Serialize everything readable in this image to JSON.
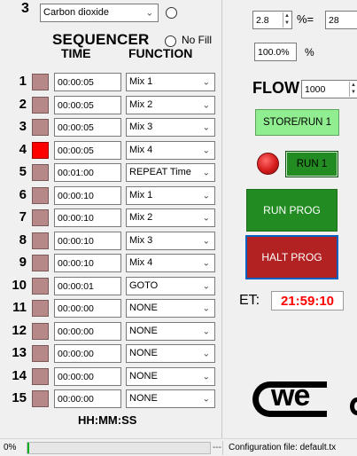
{
  "header": {
    "channel_number": "3",
    "gas_select": "Carbon dioxide",
    "sequencer_title": "SEQUENCER",
    "no_fill_label": "No Fill",
    "time_header": "TIME",
    "function_header": "FUNCTION",
    "footer_format": "HH:MM:SS"
  },
  "rows": [
    {
      "num": "1",
      "time": "00:00:05",
      "func": "Mix 1",
      "active": false
    },
    {
      "num": "2",
      "time": "00:00:05",
      "func": "Mix 2",
      "active": false
    },
    {
      "num": "3",
      "time": "00:00:05",
      "func": "Mix 3",
      "active": false
    },
    {
      "num": "4",
      "time": "00:00:05",
      "func": "Mix 4",
      "active": true
    },
    {
      "num": "5",
      "time": "00:01:00",
      "func": "REPEAT Time",
      "active": false
    },
    {
      "num": "6",
      "time": "00:00:10",
      "func": "Mix 1",
      "active": false
    },
    {
      "num": "7",
      "time": "00:00:10",
      "func": "Mix 2",
      "active": false
    },
    {
      "num": "8",
      "time": "00:00:10",
      "func": "Mix 3",
      "active": false
    },
    {
      "num": "9",
      "time": "00:00:10",
      "func": "Mix 4",
      "active": false
    },
    {
      "num": "10",
      "time": "00:00:01",
      "func": "GOTO",
      "active": false
    },
    {
      "num": "11",
      "time": "00:00:00",
      "func": "NONE",
      "active": false
    },
    {
      "num": "12",
      "time": "00:00:00",
      "func": "NONE",
      "active": false
    },
    {
      "num": "13",
      "time": "00:00:00",
      "func": "NONE",
      "active": false
    },
    {
      "num": "14",
      "time": "00:00:00",
      "func": "NONE",
      "active": false
    },
    {
      "num": "15",
      "time": "00:00:00",
      "func": "NONE",
      "active": false
    }
  ],
  "right": {
    "value_spinner": "2.8",
    "percent_eq_label": "%=",
    "value_right": "28",
    "percent_box": "100.0%",
    "percent_label": "%",
    "flow_label": "FLOW",
    "flow_value": "1000",
    "store_run_label": "STORE/RUN 1",
    "run1_label": "RUN 1",
    "run_prog_label": "RUN PROG",
    "halt_prog_label": "HALT PROG",
    "et_label": "ET:",
    "et_value": "21:59:10",
    "logo_text": "we"
  },
  "status": {
    "progress_text": "0%",
    "progress_fraction": 0.0,
    "dashes": "---",
    "config_text": "Configuration file: default.tx"
  },
  "colors": {
    "swatch_idle": "#b78888",
    "swatch_active": "#ff0000",
    "store_bg": "#90ee90",
    "run_green": "#228b22",
    "halt_red": "#b22222",
    "et_red": "#ff0000",
    "indicator": "#d61c1c"
  }
}
